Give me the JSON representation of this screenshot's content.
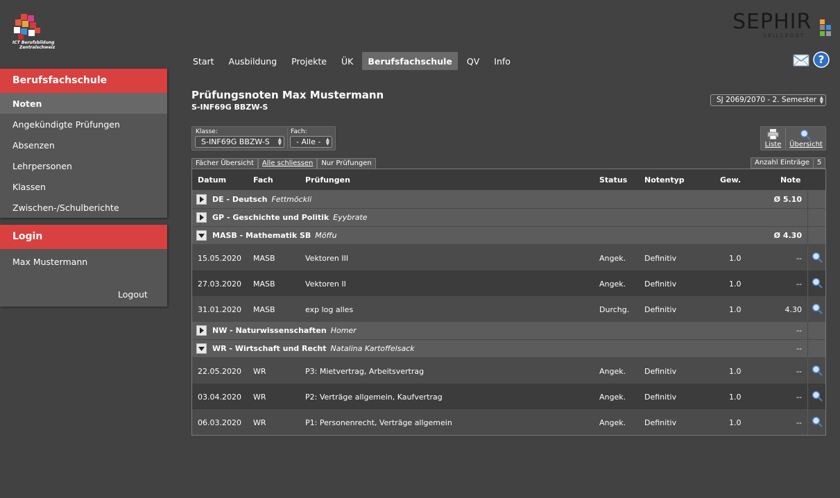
{
  "logo": {
    "caption_line1": "ICT Berufsbildung",
    "caption_line2": "Zentralschweiz"
  },
  "brand": {
    "word": "SEPHIR",
    "sub": "SKILLPORT"
  },
  "sidebar": {
    "section_title": "Berufsfachschule",
    "items": [
      {
        "label": "Noten",
        "active": true
      },
      {
        "label": "Angekündigte Prüfungen"
      },
      {
        "label": "Absenzen"
      },
      {
        "label": "Lehrpersonen"
      },
      {
        "label": "Klassen"
      },
      {
        "label": "Zwischen-/Schulberichte"
      }
    ]
  },
  "login": {
    "title": "Login",
    "user": "Max Mustermann",
    "logout": "Logout"
  },
  "nav": [
    "Start",
    "Ausbildung",
    "Projekte",
    "ÜK",
    "Berufsfachschule",
    "QV",
    "Info"
  ],
  "nav_active": "Berufsfachschule",
  "page": {
    "title": "Prüfungsnoten Max Mustermann",
    "subtitle": "S-INF69G BBZW-S"
  },
  "semester": "SJ 2069/2070 - 2. Semester",
  "filters": {
    "klasse_label": "Klasse:",
    "klasse_value": "S-INF69G BBZW-S",
    "fach_label": "Fach:",
    "fach_value": "- Alle -"
  },
  "tools": {
    "liste": "Liste",
    "uebersicht": "Übersicht"
  },
  "tabs": [
    "Fächer Übersicht",
    "Alle schliessen",
    "Nur Prüfungen"
  ],
  "entry_count": {
    "label": "Anzahl Einträge",
    "value": "5"
  },
  "table": {
    "headers": {
      "datum": "Datum",
      "fach": "Fach",
      "pruefungen": "Prüfungen",
      "status": "Status",
      "notentyp": "Notentyp",
      "gew": "Gew.",
      "note": "Note"
    },
    "groups": [
      {
        "title": "DE - Deutsch",
        "teacher": "Fettmöckli",
        "avg": "Ø 5.10",
        "expanded": false
      },
      {
        "title": "GP - Geschichte und Politik",
        "teacher": "Eyybrate",
        "avg": "",
        "expanded": false
      },
      {
        "title": "MASB - Mathematik SB",
        "teacher": "Möffu",
        "avg": "Ø 4.30",
        "expanded": true,
        "rows": [
          {
            "datum": "15.05.2020",
            "fach": "MASB",
            "pruefung": "Vektoren III",
            "status": "Angek.",
            "notentyp": "Definitiv",
            "gew": "1.0",
            "note": "--"
          },
          {
            "datum": "27.03.2020",
            "fach": "MASB",
            "pruefung": "Vektoren II",
            "status": "Angek.",
            "notentyp": "Definitiv",
            "gew": "1.0",
            "note": "--"
          },
          {
            "datum": "31.01.2020",
            "fach": "MASB",
            "pruefung": "exp log alles",
            "status": "Durchg.",
            "notentyp": "Definitiv",
            "gew": "1.0",
            "note": "4.30"
          }
        ]
      },
      {
        "title": "NW - Naturwissenschaften",
        "teacher": "Homer",
        "avg": "--",
        "expanded": false
      },
      {
        "title": "WR - Wirtschaft und Recht",
        "teacher": "Natalina Kartoffelsack",
        "avg": "--",
        "expanded": true,
        "rows": [
          {
            "datum": "22.05.2020",
            "fach": "WR",
            "pruefung": "P3: Mietvertrag, Arbeitsvertrag",
            "status": "Angek.",
            "notentyp": "Definitiv",
            "gew": "1.0",
            "note": "--"
          },
          {
            "datum": "03.04.2020",
            "fach": "WR",
            "pruefung": "P2: Verträge allgemein, Kaufvertrag",
            "status": "Angek.",
            "notentyp": "Definitiv",
            "gew": "1.0",
            "note": "--"
          },
          {
            "datum": "06.03.2020",
            "fach": "WR",
            "pruefung": "P1: Personenrecht, Verträge allgemein",
            "status": "Angek.",
            "notentyp": "Definitiv",
            "gew": "1.0",
            "note": "--"
          }
        ]
      }
    ]
  }
}
